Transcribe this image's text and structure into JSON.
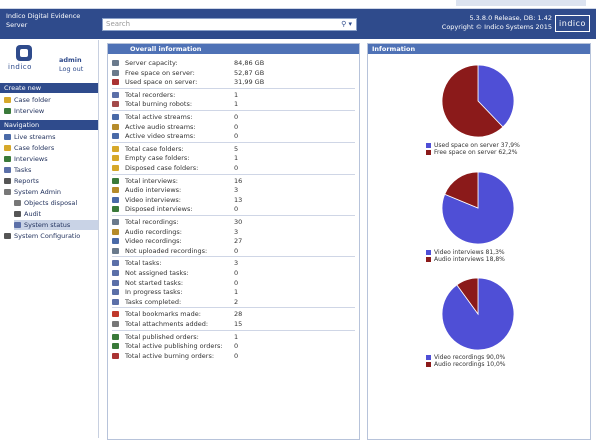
{
  "header": {
    "app_title_line1": "Indico Digital Evidence",
    "app_title_line2": "Server",
    "search_placeholder": "Search",
    "release_line1": "5.3.8.0 Release, DB: 1.42",
    "release_line2": "Copyright © Indico Systems 2015",
    "logo_text": "indico"
  },
  "colors": {
    "header_bg": "#2f4b8c",
    "panel_title_bg": "#4f72b6",
    "pie_blue": "#4f4fd6",
    "pie_red": "#8b1a1a"
  },
  "user": {
    "brand": "indico",
    "name": "admin",
    "logout": "Log out"
  },
  "sidebar": {
    "create_new_title": "Create new",
    "create_items": [
      {
        "label": "Case folder",
        "icon": "folder-icon"
      },
      {
        "label": "Interview",
        "icon": "interview-icon"
      }
    ],
    "navigation_title": "Navigation",
    "nav_items": [
      {
        "label": "Live streams",
        "icon": "stream-icon"
      },
      {
        "label": "Case folders",
        "icon": "folder-icon"
      },
      {
        "label": "Interviews",
        "icon": "interview-icon"
      },
      {
        "label": "Tasks",
        "icon": "task-icon"
      },
      {
        "label": "Reports",
        "icon": "report-icon"
      },
      {
        "label": "System Admin",
        "icon": "admin-icon"
      },
      {
        "label": "Objects disposal",
        "icon": "trash-icon"
      },
      {
        "label": "Audit",
        "icon": "audit-icon"
      },
      {
        "label": "System status",
        "icon": "status-icon",
        "selected": true
      },
      {
        "label": "System Configuratio",
        "icon": "config-icon"
      }
    ]
  },
  "overall": {
    "title": "Overall information",
    "groups": [
      [
        {
          "label": "Server capacity:",
          "value": "84,86 GB",
          "icon": "server-icon",
          "color": "#6a7a8c"
        },
        {
          "label": "Free space on server:",
          "value": "52,87 GB",
          "icon": "disk-icon",
          "color": "#6a7a8c"
        },
        {
          "label": "Used space on server:",
          "value": "31,99 GB",
          "icon": "disk-used-icon",
          "color": "#a33"
        }
      ],
      [
        {
          "label": "Total recorders:",
          "value": "1",
          "icon": "recorder-icon",
          "color": "#5b6fa8"
        },
        {
          "label": "Total burning robots:",
          "value": "1",
          "icon": "robot-icon",
          "color": "#a34a4a"
        }
      ],
      [
        {
          "label": "Total active streams:",
          "value": "0",
          "icon": "stream-icon",
          "color": "#4a6aa8"
        },
        {
          "label": "Active audio streams:",
          "value": "0",
          "icon": "audio-icon",
          "color": "#b58b2a"
        },
        {
          "label": "Active video streams:",
          "value": "0",
          "icon": "video-icon",
          "color": "#4a6aa8"
        }
      ],
      [
        {
          "label": "Total case folders:",
          "value": "5",
          "icon": "folder-icon",
          "color": "#d6a82a"
        },
        {
          "label": "Empty case folders:",
          "value": "1",
          "icon": "folder-icon",
          "color": "#d6a82a"
        },
        {
          "label": "Disposed case folders:",
          "value": "0",
          "icon": "folder-icon",
          "color": "#d6a82a"
        }
      ],
      [
        {
          "label": "Total interviews:",
          "value": "16",
          "icon": "interview-icon",
          "color": "#3a7a3a"
        },
        {
          "label": "Audio interviews:",
          "value": "3",
          "icon": "audio-icon",
          "color": "#b58b2a"
        },
        {
          "label": "Video interviews:",
          "value": "13",
          "icon": "video-icon",
          "color": "#4a6aa8"
        },
        {
          "label": "Disposed interviews:",
          "value": "0",
          "icon": "interview-icon",
          "color": "#3a7a3a"
        }
      ],
      [
        {
          "label": "Total recordings:",
          "value": "30",
          "icon": "recording-icon",
          "color": "#6a7a8c"
        },
        {
          "label": "Audio recordings:",
          "value": "3",
          "icon": "audio-icon",
          "color": "#b58b2a"
        },
        {
          "label": "Video recordings:",
          "value": "27",
          "icon": "video-icon",
          "color": "#4a6aa8"
        },
        {
          "label": "Not uploaded recordings:",
          "value": "0",
          "icon": "recording-icon",
          "color": "#6a7a8c"
        }
      ],
      [
        {
          "label": "Total tasks:",
          "value": "3",
          "icon": "task-icon",
          "color": "#5b6fa8"
        },
        {
          "label": "Not assigned tasks:",
          "value": "0",
          "icon": "task-icon",
          "color": "#5b6fa8"
        },
        {
          "label": "Not started tasks:",
          "value": "0",
          "icon": "task-icon",
          "color": "#5b6fa8"
        },
        {
          "label": "In progress tasks:",
          "value": "1",
          "icon": "task-icon",
          "color": "#5b6fa8"
        },
        {
          "label": "Tasks completed:",
          "value": "2",
          "icon": "task-icon",
          "color": "#5b6fa8"
        }
      ],
      [
        {
          "label": "Total bookmarks made:",
          "value": "28",
          "icon": "bookmark-icon",
          "color": "#c0392b"
        },
        {
          "label": "Total attachments added:",
          "value": "15",
          "icon": "attachment-icon",
          "color": "#777"
        }
      ],
      [
        {
          "label": "Total published orders:",
          "value": "1",
          "icon": "order-icon",
          "color": "#3a7a3a"
        },
        {
          "label": "Total active publishing orders:",
          "value": "0",
          "icon": "order-icon",
          "color": "#3a7a3a"
        },
        {
          "label": "Total active burning orders:",
          "value": "0",
          "icon": "burn-icon",
          "color": "#a33"
        }
      ]
    ]
  },
  "info": {
    "title": "Information"
  },
  "chart_data": [
    {
      "type": "pie",
      "series": [
        {
          "name": "Used space on server 37,9%",
          "value": 37.9,
          "color": "#4f4fd6"
        },
        {
          "name": "Free space on server 62,2%",
          "value": 62.2,
          "color": "#8b1a1a"
        }
      ]
    },
    {
      "type": "pie",
      "series": [
        {
          "name": "Video interviews 81,3%",
          "value": 81.3,
          "color": "#4f4fd6"
        },
        {
          "name": "Audio interviews 18,8%",
          "value": 18.8,
          "color": "#8b1a1a"
        }
      ]
    },
    {
      "type": "pie",
      "series": [
        {
          "name": "Video recordings 90,0%",
          "value": 90.0,
          "color": "#4f4fd6"
        },
        {
          "name": "Audio recordings 10,0%",
          "value": 10.0,
          "color": "#8b1a1a"
        }
      ]
    }
  ]
}
